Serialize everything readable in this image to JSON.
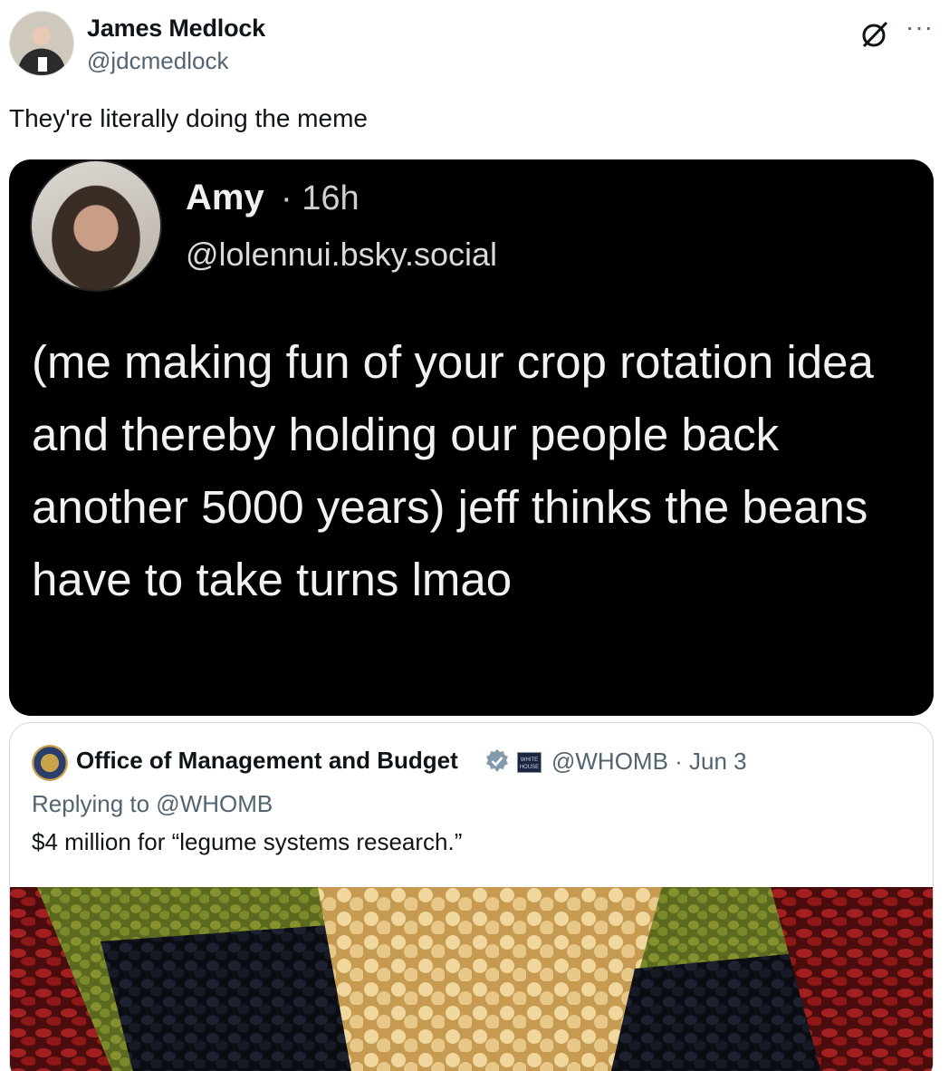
{
  "author": {
    "name": "James Medlock",
    "handle": "@jdcmedlock"
  },
  "tweet": {
    "text": "They're literally doing the meme"
  },
  "meme": {
    "name": "Amy",
    "time": "· 16h",
    "handle": "@lolennui.bsky.social",
    "text": "(me making fun of your crop rotation idea and thereby holding our people back another 5000 years) jeff thinks the beans have to take turns lmao"
  },
  "quoted_tweet": {
    "name": "Office of Management and Budget",
    "handle_date": "@WHOMB · Jun 3",
    "replying_to": "Replying to @WHOMB",
    "text": "$4 million for “legume systems research.”",
    "gov_badge_text": "WHITE HOUSE"
  },
  "colors": {
    "text_primary": "#0f1419",
    "text_secondary": "#536471",
    "verified_blue": "#829aab",
    "border": "#cfd9de"
  },
  "icons": {
    "grok": "grok-icon",
    "more": "more-icon",
    "verified": "verified-icon"
  }
}
